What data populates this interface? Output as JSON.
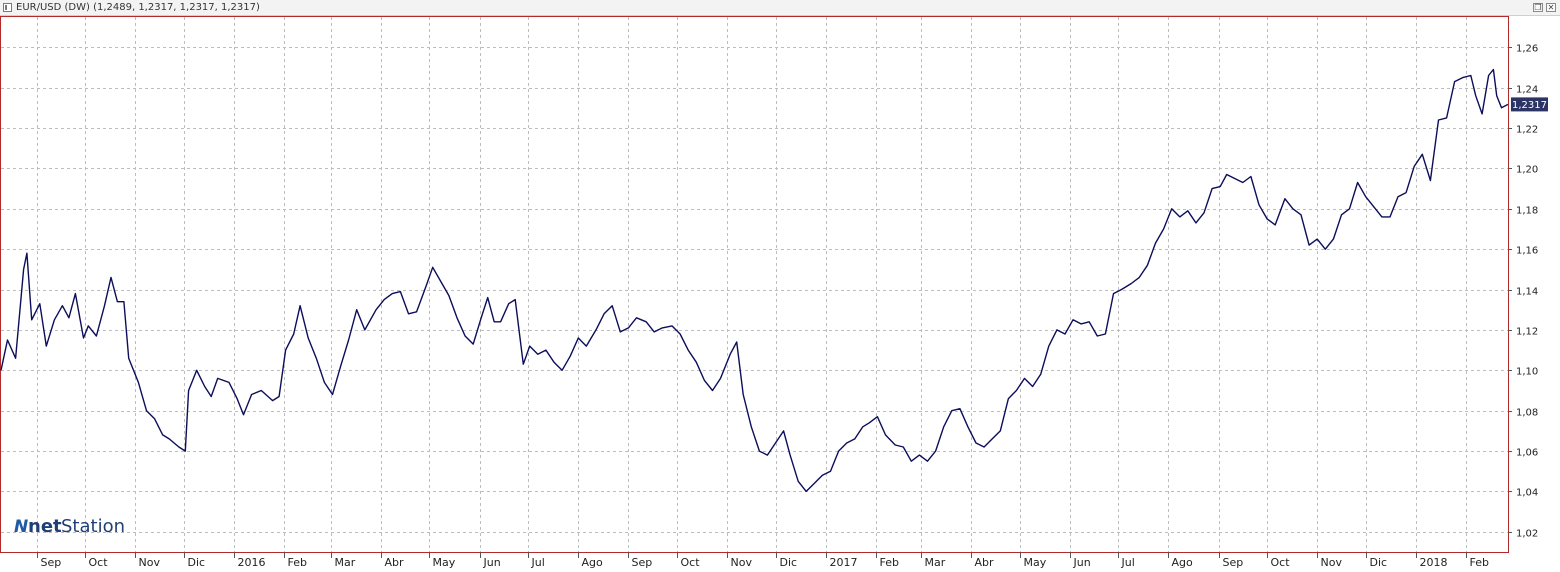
{
  "window": {
    "title": "EUR/USD (DW) (1,2489, 1,2317, 1,2317, 1,2317)",
    "restore_icon": "restore-window-icon",
    "close_icon": "close-window-icon"
  },
  "watermark": {
    "mark": "N",
    "part1": "net",
    "part2": "Station"
  },
  "colors": {
    "line": "#0c0e5a",
    "frame": "#b22a2a",
    "grid": "#bdbdbd",
    "price_badge": "#2c3466",
    "logo": "#1f3f76"
  },
  "chart_data": {
    "type": "line",
    "title": "EUR/USD (DW)",
    "xlabel": "",
    "ylabel": "",
    "ylim": [
      1.01,
      1.275
    ],
    "grid": true,
    "y_ticks": [
      "1,02",
      "1,04",
      "1,06",
      "1,08",
      "1,10",
      "1,12",
      "1,14",
      "1,16",
      "1,18",
      "1,20",
      "1,22",
      "1,24",
      "1,26"
    ],
    "y_tick_values": [
      1.02,
      1.04,
      1.06,
      1.08,
      1.1,
      1.12,
      1.14,
      1.16,
      1.18,
      1.2,
      1.22,
      1.24,
      1.26
    ],
    "x_ticks": [
      "Sep",
      "Oct",
      "Nov",
      "Dic",
      "2016",
      "Feb",
      "Mar",
      "Abr",
      "May",
      "Jun",
      "Jul",
      "Ago",
      "Sep",
      "Oct",
      "Nov",
      "Dic",
      "2017",
      "Feb",
      "Mar",
      "Abr",
      "May",
      "Jun",
      "Jul",
      "Ago",
      "Sep",
      "Oct",
      "Nov",
      "Dic",
      "2018",
      "Feb"
    ],
    "x_tick_dates": [
      "2015-09-01",
      "2015-10-01",
      "2015-11-01",
      "2015-12-01",
      "2016-01-01",
      "2016-02-01",
      "2016-03-01",
      "2016-04-01",
      "2016-05-01",
      "2016-06-01",
      "2016-07-01",
      "2016-08-01",
      "2016-09-01",
      "2016-10-01",
      "2016-11-01",
      "2016-12-01",
      "2017-01-01",
      "2017-02-01",
      "2017-03-01",
      "2017-04-01",
      "2017-05-01",
      "2017-06-01",
      "2017-07-01",
      "2017-08-01",
      "2017-09-01",
      "2017-10-01",
      "2017-11-01",
      "2017-12-01",
      "2018-01-01",
      "2018-02-01"
    ],
    "x_range": [
      "2015-08-10",
      "2018-02-27"
    ],
    "last_price_label": "1,2317",
    "last_price": 1.2317,
    "series": [
      {
        "name": "EUR/USD",
        "points": [
          [
            "2015-08-10",
            1.1
          ],
          [
            "2015-08-14",
            1.115
          ],
          [
            "2015-08-19",
            1.106
          ],
          [
            "2015-08-24",
            1.15
          ],
          [
            "2015-08-26",
            1.158
          ],
          [
            "2015-08-29",
            1.125
          ],
          [
            "2015-09-03",
            1.133
          ],
          [
            "2015-09-07",
            1.112
          ],
          [
            "2015-09-12",
            1.125
          ],
          [
            "2015-09-17",
            1.132
          ],
          [
            "2015-09-21",
            1.126
          ],
          [
            "2015-09-25",
            1.138
          ],
          [
            "2015-09-30",
            1.116
          ],
          [
            "2015-10-03",
            1.122
          ],
          [
            "2015-10-08",
            1.117
          ],
          [
            "2015-10-13",
            1.132
          ],
          [
            "2015-10-17",
            1.146
          ],
          [
            "2015-10-21",
            1.134
          ],
          [
            "2015-10-25",
            1.134
          ],
          [
            "2015-10-28",
            1.106
          ],
          [
            "2015-11-03",
            1.094
          ],
          [
            "2015-11-08",
            1.08
          ],
          [
            "2015-11-13",
            1.076
          ],
          [
            "2015-11-18",
            1.068
          ],
          [
            "2015-11-22",
            1.066
          ],
          [
            "2015-11-28",
            1.062
          ],
          [
            "2015-12-02",
            1.06
          ],
          [
            "2015-12-04",
            1.09
          ],
          [
            "2015-12-09",
            1.1
          ],
          [
            "2015-12-14",
            1.092
          ],
          [
            "2015-12-18",
            1.087
          ],
          [
            "2015-12-22",
            1.096
          ],
          [
            "2015-12-29",
            1.094
          ],
          [
            "2016-01-03",
            1.086
          ],
          [
            "2016-01-07",
            1.078
          ],
          [
            "2016-01-12",
            1.088
          ],
          [
            "2016-01-18",
            1.09
          ],
          [
            "2016-01-25",
            1.085
          ],
          [
            "2016-01-29",
            1.087
          ],
          [
            "2016-02-02",
            1.11
          ],
          [
            "2016-02-07",
            1.118
          ],
          [
            "2016-02-11",
            1.132
          ],
          [
            "2016-02-16",
            1.116
          ],
          [
            "2016-02-21",
            1.106
          ],
          [
            "2016-02-26",
            1.094
          ],
          [
            "2016-03-02",
            1.088
          ],
          [
            "2016-03-07",
            1.102
          ],
          [
            "2016-03-12",
            1.115
          ],
          [
            "2016-03-17",
            1.13
          ],
          [
            "2016-03-22",
            1.12
          ],
          [
            "2016-03-29",
            1.13
          ],
          [
            "2016-04-03",
            1.135
          ],
          [
            "2016-04-08",
            1.138
          ],
          [
            "2016-04-13",
            1.139
          ],
          [
            "2016-04-18",
            1.128
          ],
          [
            "2016-04-23",
            1.129
          ],
          [
            "2016-04-29",
            1.142
          ],
          [
            "2016-05-03",
            1.151
          ],
          [
            "2016-05-08",
            1.144
          ],
          [
            "2016-05-13",
            1.137
          ],
          [
            "2016-05-18",
            1.126
          ],
          [
            "2016-05-23",
            1.117
          ],
          [
            "2016-05-28",
            1.113
          ],
          [
            "2016-06-02",
            1.126
          ],
          [
            "2016-06-06",
            1.136
          ],
          [
            "2016-06-10",
            1.124
          ],
          [
            "2016-06-14",
            1.124
          ],
          [
            "2016-06-19",
            1.133
          ],
          [
            "2016-06-23",
            1.135
          ],
          [
            "2016-06-28",
            1.103
          ],
          [
            "2016-07-02",
            1.112
          ],
          [
            "2016-07-07",
            1.108
          ],
          [
            "2016-07-12",
            1.11
          ],
          [
            "2016-07-17",
            1.104
          ],
          [
            "2016-07-22",
            1.1
          ],
          [
            "2016-07-27",
            1.107
          ],
          [
            "2016-08-01",
            1.116
          ],
          [
            "2016-08-06",
            1.112
          ],
          [
            "2016-08-12",
            1.12
          ],
          [
            "2016-08-17",
            1.128
          ],
          [
            "2016-08-22",
            1.132
          ],
          [
            "2016-08-27",
            1.119
          ],
          [
            "2016-09-01",
            1.121
          ],
          [
            "2016-09-06",
            1.126
          ],
          [
            "2016-09-12",
            1.124
          ],
          [
            "2016-09-17",
            1.119
          ],
          [
            "2016-09-22",
            1.121
          ],
          [
            "2016-09-28",
            1.122
          ],
          [
            "2016-10-03",
            1.118
          ],
          [
            "2016-10-08",
            1.11
          ],
          [
            "2016-10-13",
            1.104
          ],
          [
            "2016-10-18",
            1.095
          ],
          [
            "2016-10-23",
            1.09
          ],
          [
            "2016-10-28",
            1.096
          ],
          [
            "2016-11-03",
            1.108
          ],
          [
            "2016-11-07",
            1.114
          ],
          [
            "2016-11-11",
            1.088
          ],
          [
            "2016-11-16",
            1.072
          ],
          [
            "2016-11-21",
            1.06
          ],
          [
            "2016-11-26",
            1.058
          ],
          [
            "2016-12-01",
            1.064
          ],
          [
            "2016-12-06",
            1.07
          ],
          [
            "2016-12-10",
            1.058
          ],
          [
            "2016-12-15",
            1.045
          ],
          [
            "2016-12-20",
            1.04
          ],
          [
            "2016-12-25",
            1.044
          ],
          [
            "2016-12-30",
            1.048
          ],
          [
            "2017-01-04",
            1.05
          ],
          [
            "2017-01-09",
            1.06
          ],
          [
            "2017-01-14",
            1.064
          ],
          [
            "2017-01-19",
            1.066
          ],
          [
            "2017-01-24",
            1.072
          ],
          [
            "2017-01-28",
            1.074
          ],
          [
            "2017-02-02",
            1.077
          ],
          [
            "2017-02-07",
            1.068
          ],
          [
            "2017-02-13",
            1.063
          ],
          [
            "2017-02-18",
            1.062
          ],
          [
            "2017-02-23",
            1.055
          ],
          [
            "2017-02-28",
            1.058
          ],
          [
            "2017-03-05",
            1.055
          ],
          [
            "2017-03-10",
            1.06
          ],
          [
            "2017-03-15",
            1.072
          ],
          [
            "2017-03-20",
            1.08
          ],
          [
            "2017-03-25",
            1.081
          ],
          [
            "2017-03-30",
            1.072
          ],
          [
            "2017-04-04",
            1.064
          ],
          [
            "2017-04-09",
            1.062
          ],
          [
            "2017-04-14",
            1.066
          ],
          [
            "2017-04-19",
            1.07
          ],
          [
            "2017-04-24",
            1.086
          ],
          [
            "2017-04-29",
            1.09
          ],
          [
            "2017-05-04",
            1.096
          ],
          [
            "2017-05-09",
            1.092
          ],
          [
            "2017-05-14",
            1.098
          ],
          [
            "2017-05-19",
            1.112
          ],
          [
            "2017-05-24",
            1.12
          ],
          [
            "2017-05-29",
            1.118
          ],
          [
            "2017-06-03",
            1.125
          ],
          [
            "2017-06-08",
            1.123
          ],
          [
            "2017-06-13",
            1.124
          ],
          [
            "2017-06-18",
            1.117
          ],
          [
            "2017-06-23",
            1.118
          ],
          [
            "2017-06-28",
            1.138
          ],
          [
            "2017-07-03",
            1.14
          ],
          [
            "2017-07-09",
            1.143
          ],
          [
            "2017-07-14",
            1.146
          ],
          [
            "2017-07-19",
            1.152
          ],
          [
            "2017-07-24",
            1.163
          ],
          [
            "2017-07-29",
            1.17
          ],
          [
            "2017-08-03",
            1.18
          ],
          [
            "2017-08-08",
            1.176
          ],
          [
            "2017-08-13",
            1.179
          ],
          [
            "2017-08-18",
            1.173
          ],
          [
            "2017-08-23",
            1.178
          ],
          [
            "2017-08-28",
            1.19
          ],
          [
            "2017-09-02",
            1.191
          ],
          [
            "2017-09-06",
            1.197
          ],
          [
            "2017-09-11",
            1.195
          ],
          [
            "2017-09-16",
            1.193
          ],
          [
            "2017-09-21",
            1.196
          ],
          [
            "2017-09-26",
            1.182
          ],
          [
            "2017-10-01",
            1.175
          ],
          [
            "2017-10-06",
            1.172
          ],
          [
            "2017-10-12",
            1.185
          ],
          [
            "2017-10-17",
            1.18
          ],
          [
            "2017-10-22",
            1.177
          ],
          [
            "2017-10-27",
            1.162
          ],
          [
            "2017-11-01",
            1.165
          ],
          [
            "2017-11-06",
            1.16
          ],
          [
            "2017-11-11",
            1.165
          ],
          [
            "2017-11-16",
            1.177
          ],
          [
            "2017-11-21",
            1.18
          ],
          [
            "2017-11-26",
            1.193
          ],
          [
            "2017-12-01",
            1.186
          ],
          [
            "2017-12-06",
            1.181
          ],
          [
            "2017-12-11",
            1.176
          ],
          [
            "2017-12-16",
            1.176
          ],
          [
            "2017-12-21",
            1.186
          ],
          [
            "2017-12-26",
            1.188
          ],
          [
            "2017-12-31",
            1.201
          ],
          [
            "2018-01-05",
            1.207
          ],
          [
            "2018-01-10",
            1.194
          ],
          [
            "2018-01-15",
            1.224
          ],
          [
            "2018-01-20",
            1.225
          ],
          [
            "2018-01-25",
            1.243
          ],
          [
            "2018-01-30",
            1.245
          ],
          [
            "2018-02-04",
            1.246
          ],
          [
            "2018-02-07",
            1.236
          ],
          [
            "2018-02-11",
            1.227
          ],
          [
            "2018-02-15",
            1.246
          ],
          [
            "2018-02-18",
            1.249
          ],
          [
            "2018-02-20",
            1.236
          ],
          [
            "2018-02-23",
            1.23
          ],
          [
            "2018-02-27",
            1.2317
          ]
        ]
      }
    ]
  }
}
